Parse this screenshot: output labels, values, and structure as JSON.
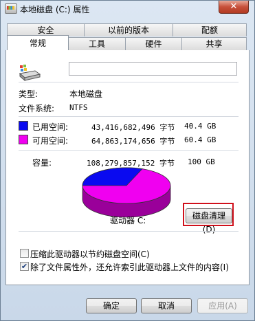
{
  "window": {
    "title": "本地磁盘 (C:) 属性",
    "close_label": "✕"
  },
  "tabs_top": [
    "安全",
    "以前的版本",
    "配额"
  ],
  "tabs_bottom": [
    "常规",
    "工具",
    "硬件",
    "共享"
  ],
  "active_tab": "常规",
  "general": {
    "name_value": "",
    "type_label": "类型:",
    "type_value": "本地磁盘",
    "fs_label": "文件系统:",
    "fs_value": "NTFS",
    "used": {
      "label": "已用空间:",
      "bytes": "43,416,682,496 字节",
      "size": "40.4 GB",
      "color": "#0a0af0"
    },
    "free": {
      "label": "可用空间:",
      "bytes": "64,863,174,656 字节",
      "size": "60.4 GB",
      "color": "#f000f0"
    },
    "capacity": {
      "label": "容量:",
      "bytes": "108,279,857,152 字节",
      "size": "100 GB"
    },
    "drive_label": "驱动器 C:",
    "cleanup_button": "磁盘清理(D)",
    "compress_checkbox": {
      "label": "压缩此驱动器以节约磁盘空间(C)",
      "checked": false
    },
    "index_checkbox": {
      "label": "除了文件属性外，还允许索引此驱动器上文件的内容(I)",
      "checked": true
    }
  },
  "footer": {
    "ok": "确定",
    "cancel": "取消",
    "apply": "应用(A)"
  }
}
